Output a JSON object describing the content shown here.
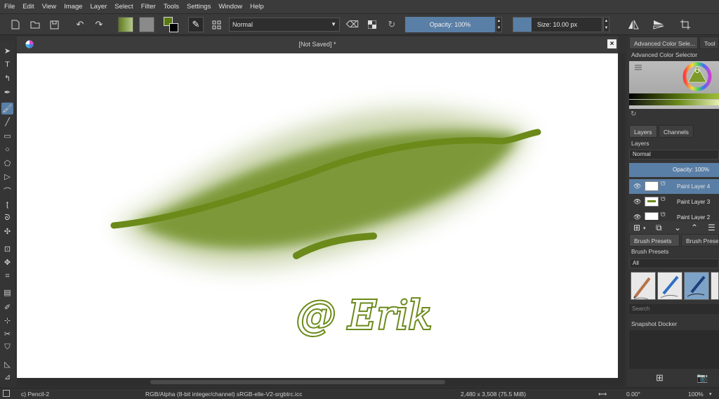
{
  "menu": [
    "File",
    "Edit",
    "View",
    "Image",
    "Layer",
    "Select",
    "Filter",
    "Tools",
    "Settings",
    "Window",
    "Help"
  ],
  "toolbar": {
    "blend_mode": "Normal",
    "opacity_label": "Opacity: 100%",
    "size_label": "Size: 10.00 px"
  },
  "document": {
    "title": "[Not Saved]  *",
    "close": "×",
    "signature_text": "@ Erik"
  },
  "docker": {
    "tab_color": "Advanced Color Sele...",
    "tab_tool": "Tool",
    "color_selector_title": "Advanced Color Selector",
    "tab_layers": "Layers",
    "tab_channels": "Channels",
    "layers_title": "Layers",
    "layer_blend": "Normal",
    "layer_opacity": "Opacity:  100%",
    "layers": [
      {
        "name": "Paint Layer 4",
        "selected": true
      },
      {
        "name": "Paint Layer 3",
        "selected": false
      },
      {
        "name": "Paint Layer 2",
        "selected": false
      }
    ],
    "tab_brush_presets": "Brush Presets",
    "tab_brush_presets_2": "Brush Preset H",
    "brush_presets_title": "Brush Presets",
    "preset_filter": "All",
    "preset_search": "Search",
    "snapshot_title": "Snapshot Docker"
  },
  "status": {
    "brush": "c) Pencil-2",
    "color_space": "RGB/Alpha (8-bit integer/channel)  sRGB-elle-V2-srgbtrc.icc",
    "dimensions": "2,480 x 3,508 (75.5 MiB)",
    "rotation": "0.00°",
    "zoom": "100%"
  },
  "colors": {
    "paint_green": "#6b8a1a",
    "accent_blue": "#5a7fa6",
    "fg_color": "#5a7a10",
    "bg_color": "#ffffff"
  }
}
